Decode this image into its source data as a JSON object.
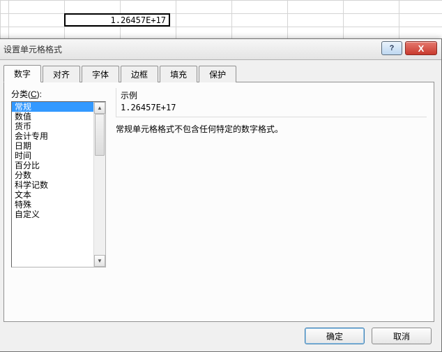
{
  "spreadsheet": {
    "selected_cell_value": "1.26457E+17"
  },
  "dialog": {
    "title": "设置单元格格式",
    "help_tooltip": "?",
    "close_tooltip": "X",
    "tabs": [
      {
        "label": "数字",
        "active": true
      },
      {
        "label": "对齐",
        "active": false
      },
      {
        "label": "字体",
        "active": false
      },
      {
        "label": "边框",
        "active": false
      },
      {
        "label": "填充",
        "active": false
      },
      {
        "label": "保护",
        "active": false
      }
    ],
    "number_tab": {
      "category_label_prefix": "分类(",
      "category_label_key": "C",
      "category_label_suffix": "):",
      "categories": [
        "常规",
        "数值",
        "货币",
        "会计专用",
        "日期",
        "时间",
        "百分比",
        "分数",
        "科学记数",
        "文本",
        "特殊",
        "自定义"
      ],
      "selected_category_index": 0,
      "example_title": "示例",
      "example_value": "1.26457E+17",
      "description": "常规单元格格式不包含任何特定的数字格式。"
    },
    "buttons": {
      "ok": "确定",
      "cancel": "取消"
    }
  }
}
